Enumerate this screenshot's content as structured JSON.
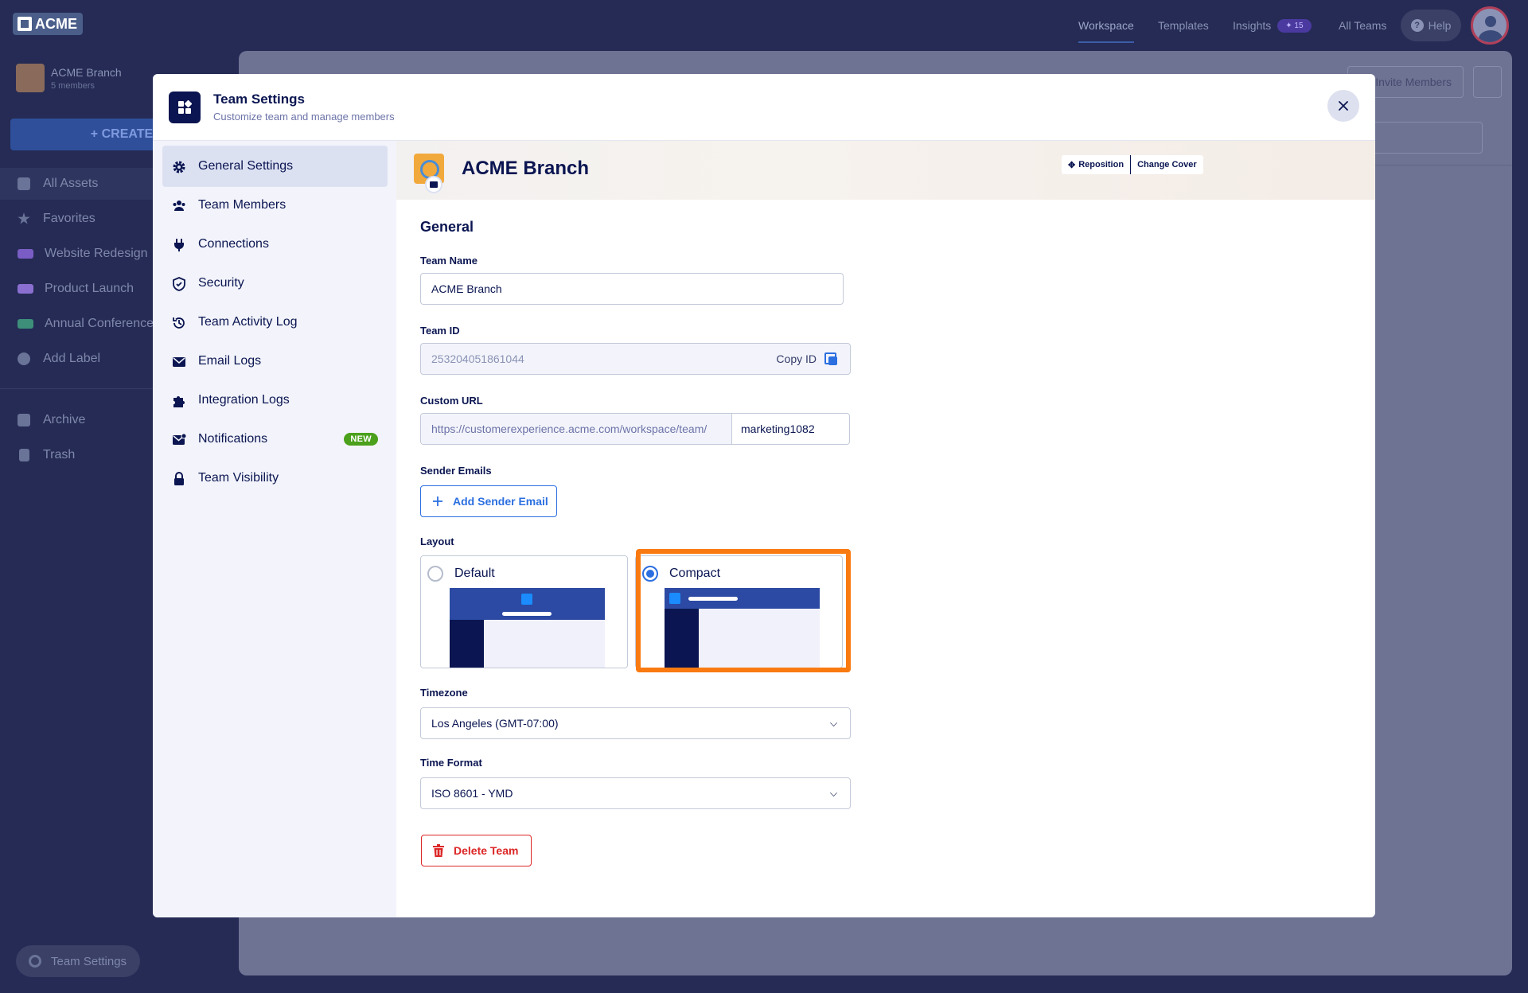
{
  "topbar": {
    "logo": "ACME",
    "nav": [
      "Workspace",
      "Templates",
      "Insights",
      "All Teams"
    ],
    "insights_badge": "15",
    "help": "Help"
  },
  "app_sidebar": {
    "team_name": "ACME Branch",
    "team_members": "5 members",
    "create": "+ CREATE",
    "items": [
      "All Assets",
      "Favorites",
      "Website Redesign",
      "Product Launch",
      "Annual Conference",
      "Add Label"
    ],
    "items2": [
      "Archive",
      "Trash"
    ],
    "team_settings": "Team Settings",
    "label_colors": [
      "#7a5dc4",
      "#8a6fd0",
      "#3d8f7a"
    ]
  },
  "background": {
    "invite_members": "Invite Members"
  },
  "modal": {
    "title": "Team Settings",
    "subtitle": "Customize team and manage members",
    "nav": [
      {
        "label": "General Settings",
        "icon": "gear-icon"
      },
      {
        "label": "Team Members",
        "icon": "users-icon"
      },
      {
        "label": "Connections",
        "icon": "plug-icon"
      },
      {
        "label": "Security",
        "icon": "shield-icon"
      },
      {
        "label": "Team Activity Log",
        "icon": "history-icon"
      },
      {
        "label": "Email Logs",
        "icon": "envelope-icon"
      },
      {
        "label": "Integration Logs",
        "icon": "puzzle-icon"
      },
      {
        "label": "Notifications",
        "icon": "mail-notification-icon"
      },
      {
        "label": "Team Visibility",
        "icon": "lock-icon"
      }
    ],
    "new_badge": "NEW",
    "cover": {
      "team_name": "ACME Branch",
      "reposition": "Reposition",
      "change_cover": "Change Cover"
    },
    "general": {
      "heading": "General",
      "team_name_label": "Team Name",
      "team_name_value": "ACME Branch",
      "team_id_label": "Team ID",
      "team_id_value": "253204051861044",
      "copy_id": "Copy ID",
      "custom_url_label": "Custom URL",
      "custom_url_prefix": "https://customerexperience.acme.com/workspace/team/",
      "custom_url_slug": "marketing1082",
      "sender_emails_label": "Sender Emails",
      "add_sender_email": "Add Sender Email",
      "layout_label": "Layout",
      "layout_default": "Default",
      "layout_compact": "Compact",
      "layout_selected": "Compact",
      "timezone_label": "Timezone",
      "timezone_value": "Los Angeles (GMT-07:00)",
      "time_format_label": "Time Format",
      "time_format_value": "ISO 8601 - YMD",
      "delete_team": "Delete Team"
    },
    "accent_color": "#2b6fe0",
    "highlight_color": "#f97a11",
    "danger_color": "#dc2626"
  }
}
